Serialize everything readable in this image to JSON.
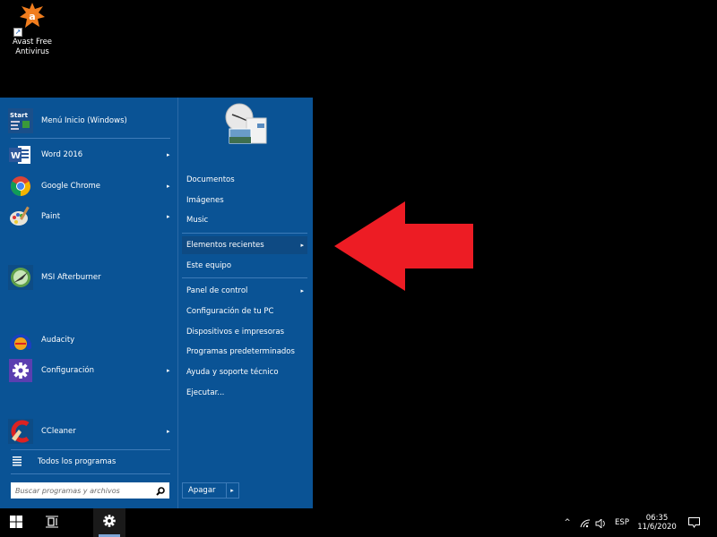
{
  "desktop": {
    "icons": [
      {
        "name": "Avast Free Antivirus",
        "label_line1": "Avast Free",
        "label_line2": "Antivirus",
        "icon": "avast-icon",
        "color": "#f07d1e"
      }
    ]
  },
  "start_menu": {
    "background": "#0a5395",
    "pinned_programs": [
      {
        "label": "Menú Inicio (Windows)",
        "icon": "start-menu-icon",
        "has_submenu": false
      },
      {
        "label": "Word 2016",
        "icon": "word-icon",
        "has_submenu": true
      },
      {
        "label": "Google Chrome",
        "icon": "chrome-icon",
        "has_submenu": true
      },
      {
        "label": "Paint",
        "icon": "paint-icon",
        "has_submenu": true
      },
      {
        "label": "MSI Afterburner",
        "icon": "msi-afterburner-icon",
        "has_submenu": false
      },
      {
        "label": "Audacity",
        "icon": "audacity-icon",
        "has_submenu": false
      },
      {
        "label": "Configuración",
        "icon": "settings-gear-icon",
        "has_submenu": true
      },
      {
        "label": "CCleaner",
        "icon": "ccleaner-icon",
        "has_submenu": true
      }
    ],
    "all_programs_label": "Todos los programas",
    "search_placeholder": "Buscar programas y archivos",
    "right_items": [
      {
        "label": "Documentos",
        "has_submenu": false
      },
      {
        "label": "Imágenes",
        "has_submenu": false
      },
      {
        "label": "Music",
        "has_submenu": false
      },
      {
        "label": "Elementos recientes",
        "has_submenu": true,
        "highlighted": true
      },
      {
        "label": "Este equipo",
        "has_submenu": false
      },
      {
        "label": "Panel de control",
        "has_submenu": true
      },
      {
        "label": "Configuración de tu PC",
        "has_submenu": false
      },
      {
        "label": "Dispositivos e impresoras",
        "has_submenu": false
      },
      {
        "label": "Programas predeterminados",
        "has_submenu": false
      },
      {
        "label": "Ayuda y soporte técnico",
        "has_submenu": false
      },
      {
        "label": "Ejecutar...",
        "has_submenu": false
      }
    ],
    "shutdown_label": "Apagar",
    "chevron": "▸"
  },
  "annotation": {
    "arrow_color": "#ed1c24",
    "direction": "left",
    "points_to": "Elementos recientes"
  },
  "taskbar": {
    "buttons": [
      {
        "name": "start",
        "icon": "windows-logo-icon"
      },
      {
        "name": "task-view",
        "icon": "task-view-icon"
      },
      {
        "name": "settings",
        "icon": "settings-gear-icon",
        "active": true
      }
    ],
    "tray": {
      "chevron": "^",
      "language": "ESP",
      "time": "06:35",
      "date": "11/6/2020"
    }
  }
}
